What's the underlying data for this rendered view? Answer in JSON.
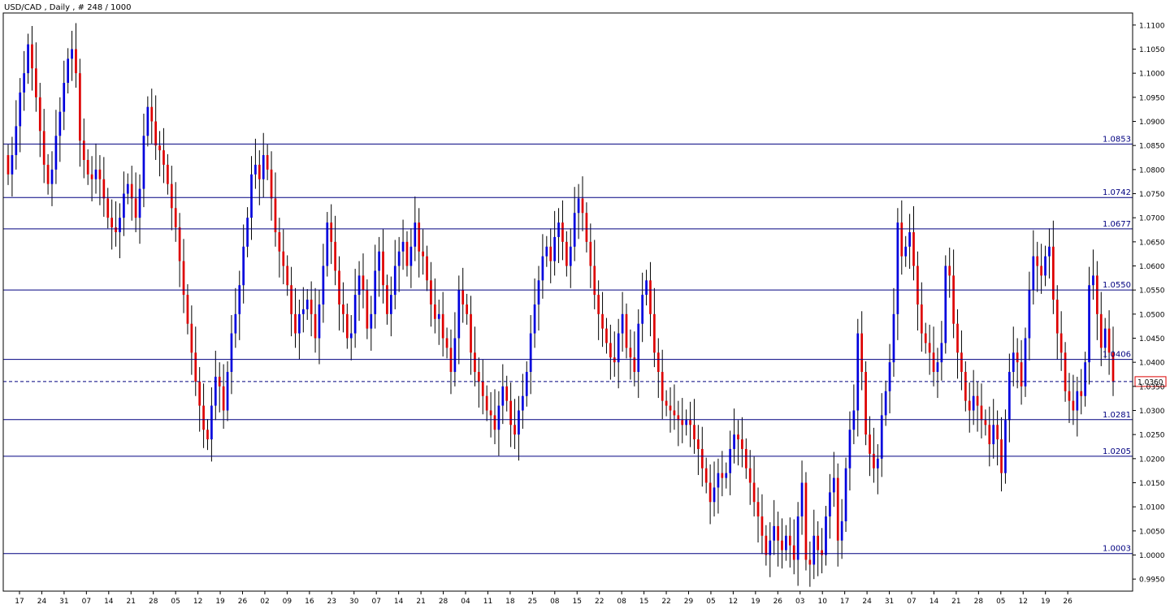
{
  "header": {
    "symbol_label": "USD/CAD , Daily , # 248 / 1000"
  },
  "chart_data": {
    "type": "candlestick",
    "title": "USD/CAD , Daily , # 248 / 1000",
    "ylim": [
      0.9925,
      1.1125
    ],
    "y_ticks": [
      "1.1100",
      "1.1050",
      "1.1000",
      "1.0950",
      "1.0900",
      "1.0850",
      "1.0800",
      "1.0750",
      "1.0700",
      "1.0650",
      "1.0600",
      "1.0550",
      "1.0500",
      "1.0450",
      "1.0400",
      "1.0350",
      "1.0300",
      "1.0250",
      "1.0200",
      "1.0150",
      "1.0100",
      "1.0050",
      "1.0000",
      "0.9950"
    ],
    "x_ticks": [
      "17",
      "24",
      "31",
      "07",
      "14",
      "21",
      "28",
      "05",
      "12",
      "19",
      "26",
      "02",
      "09",
      "16",
      "23",
      "30",
      "07",
      "14",
      "21",
      "28",
      "04",
      "11",
      "18",
      "25",
      "08",
      "15",
      "22",
      "08",
      "15",
      "22",
      "29",
      "05",
      "12",
      "19",
      "26",
      "03",
      "10",
      "17",
      "24",
      "31",
      "07",
      "14",
      "21",
      "28",
      "05",
      "12",
      "19",
      "26"
    ],
    "levels": [
      "1.0853",
      "1.0742",
      "1.0677",
      "1.0550",
      "1.0406",
      "1.0281",
      "1.0205",
      "1.0003"
    ],
    "current_price": "1.0360",
    "colors": {
      "up": "#0000dd",
      "down": "#dd0000",
      "level_line": "#000080",
      "current_marker": "#dd0000",
      "grid_line": "#000000"
    },
    "closes": [
      1.079,
      1.083,
      1.089,
      1.096,
      1.1,
      1.106,
      1.101,
      1.095,
      1.088,
      1.081,
      1.077,
      1.08,
      1.087,
      1.092,
      1.098,
      1.103,
      1.105,
      1.1,
      1.086,
      1.082,
      1.079,
      1.078,
      1.08,
      1.078,
      1.074,
      1.07,
      1.068,
      1.067,
      1.07,
      1.075,
      1.077,
      1.074,
      1.07,
      1.076,
      1.087,
      1.093,
      1.09,
      1.085,
      1.084,
      1.081,
      1.077,
      1.072,
      1.068,
      1.061,
      1.054,
      1.048,
      1.042,
      1.036,
      1.031,
      1.026,
      1.024,
      1.031,
      1.037,
      1.035,
      1.03,
      1.038,
      1.046,
      1.05,
      1.056,
      1.064,
      1.07,
      1.079,
      1.081,
      1.078,
      1.083,
      1.08,
      1.074,
      1.067,
      1.063,
      1.06,
      1.056,
      1.05,
      1.046,
      1.05,
      1.051,
      1.053,
      1.05,
      1.045,
      1.052,
      1.06,
      1.069,
      1.065,
      1.059,
      1.052,
      1.05,
      1.045,
      1.046,
      1.054,
      1.058,
      1.055,
      1.047,
      1.05,
      1.059,
      1.063,
      1.056,
      1.05,
      1.054,
      1.06,
      1.063,
      1.065,
      1.06,
      1.064,
      1.069,
      1.063,
      1.062,
      1.057,
      1.052,
      1.049,
      1.05,
      1.045,
      1.043,
      1.038,
      1.045,
      1.055,
      1.052,
      1.05,
      1.042,
      1.038,
      1.036,
      1.033,
      1.03,
      1.029,
      1.026,
      1.031,
      1.035,
      1.032,
      1.027,
      1.025,
      1.03,
      1.033,
      1.038,
      1.046,
      1.052,
      1.057,
      1.062,
      1.064,
      1.061,
      1.066,
      1.069,
      1.065,
      1.06,
      1.064,
      1.071,
      1.074,
      1.071,
      1.065,
      1.06,
      1.054,
      1.05,
      1.047,
      1.044,
      1.041,
      1.04,
      1.046,
      1.05,
      1.043,
      1.041,
      1.038,
      1.048,
      1.054,
      1.057,
      1.05,
      1.042,
      1.038,
      1.032,
      1.031,
      1.03,
      1.029,
      1.028,
      1.027,
      1.028,
      1.027,
      1.024,
      1.022,
      1.018,
      1.015,
      1.011,
      1.014,
      1.017,
      1.016,
      1.017,
      1.022,
      1.025,
      1.024,
      1.022,
      1.018,
      1.015,
      1.011,
      1.008,
      1.004,
      1.0,
      1.003,
      1.006,
      1.003,
      1.001,
      1.004,
      1.002,
      0.999,
      1.008,
      1.015,
      0.999,
      0.998,
      1.004,
      1.001,
      1.0,
      1.008,
      1.013,
      1.016,
      1.003,
      1.007,
      1.018,
      1.026,
      1.03,
      1.046,
      1.038,
      1.025,
      1.021,
      1.018,
      1.02,
      1.029,
      1.034,
      1.04,
      1.05,
      1.069,
      1.062,
      1.064,
      1.067,
      1.06,
      1.052,
      1.046,
      1.044,
      1.042,
      1.038,
      1.04,
      1.044,
      1.06,
      1.058,
      1.048,
      1.042,
      1.038,
      1.032,
      1.03,
      1.033,
      1.031,
      1.028,
      1.027,
      1.023,
      1.027,
      1.024,
      1.017,
      1.028,
      1.038,
      1.042,
      1.04,
      1.035,
      1.045,
      1.055,
      1.062,
      1.06,
      1.058,
      1.062,
      1.064,
      1.053,
      1.046,
      1.042,
      1.034,
      1.032,
      1.03,
      1.034,
      1.033,
      1.04,
      1.056,
      1.058,
      1.05,
      1.043,
      1.047,
      1.042,
      1.036
    ]
  }
}
